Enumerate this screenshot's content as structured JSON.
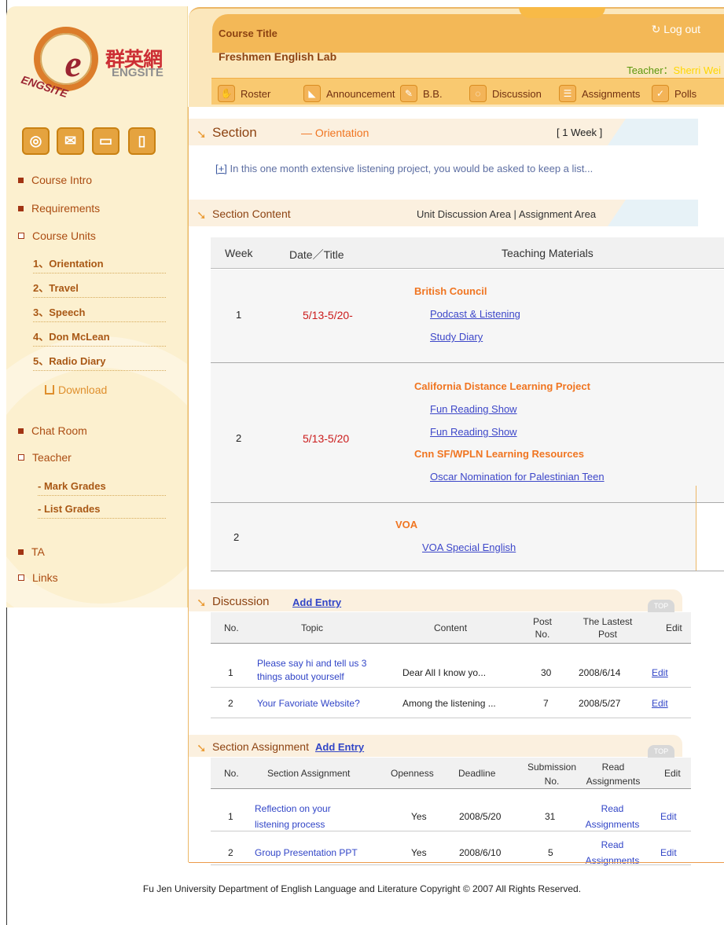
{
  "brand": {
    "cn": "群英網",
    "en": "ENGSITE",
    "circle": "ENGSITE"
  },
  "header": {
    "course_title": "Course Title",
    "course_name": "Freshmen English Lab",
    "logout": "Log out",
    "teacher_label": "Teacher：",
    "teacher_name": "Sherri Wei"
  },
  "nav": [
    {
      "label": "Roster",
      "icon": "hand-icon"
    },
    {
      "label": "Announcement",
      "icon": "megaphone-icon"
    },
    {
      "label": "B.B.",
      "icon": "pin-icon"
    },
    {
      "label": "Discussion",
      "icon": "chat-icon"
    },
    {
      "label": "Assignments",
      "icon": "doc-icon"
    },
    {
      "label": "Polls",
      "icon": "check-icon"
    }
  ],
  "sidebar": {
    "items": [
      "Course Intro",
      "Requirements",
      "Course Units",
      "Chat Room",
      "Teacher",
      "TA",
      "Links"
    ],
    "units": [
      "1、Orientation",
      "2、Travel",
      "3、Speech",
      "4、Don McLean",
      "5、Radio Diary"
    ],
    "download": "Download",
    "teacher_subs": [
      "- Mark Grades",
      "- List Grades"
    ]
  },
  "section": {
    "title": "Section",
    "desc": "— Orientation",
    "week": "[ 1 Week ]",
    "intro_prefix": "[+]",
    "intro": "In this one month extensive listening project, you would be asked to keep a list..."
  },
  "section_content": {
    "title": "Section Content",
    "links": "Unit Discussion Area | Assignment Area",
    "headers": [
      "Week",
      "Date／Title",
      "Teaching Materials"
    ],
    "rows": [
      {
        "week": "1",
        "date": "5/13-5/20-",
        "items": [
          {
            "type": "org",
            "text": "British Council"
          },
          {
            "type": "link",
            "text": "Podcast & Listening"
          },
          {
            "type": "link",
            "text": "Study Diary"
          }
        ]
      },
      {
        "week": "2",
        "date": "5/13-5/20",
        "items": [
          {
            "type": "org",
            "text": "California Distance Learning Project"
          },
          {
            "type": "link",
            "text": "Fun Reading Show"
          },
          {
            "type": "link",
            "text": "Fun Reading Show"
          },
          {
            "type": "org",
            "text": "Cnn SF/WPLN Learning Resources"
          },
          {
            "type": "link",
            "text": "Oscar Nomination for Palestinian Teen"
          }
        ]
      },
      {
        "week": "2",
        "date": "",
        "items": [
          {
            "type": "org",
            "text": "VOA"
          },
          {
            "type": "link",
            "text": "VOA Special English"
          }
        ]
      }
    ]
  },
  "discussion": {
    "title": "Discussion",
    "add": "Add Entry",
    "top": "TOP",
    "headers": [
      "No.",
      "Topic",
      "Content",
      "Post No.",
      "The Lastest Post",
      "Edit"
    ],
    "rows": [
      {
        "no": "1",
        "topic": "Please say hi and tell us 3 things about yourself",
        "content": "Dear All I know yo...",
        "posts": "30",
        "last": "2008/6/14",
        "edit": "Edit"
      },
      {
        "no": "2",
        "topic": "Your Favoriate Website?",
        "content": "Among the listening ...",
        "posts": "7",
        "last": "2008/5/27",
        "edit": "Edit"
      }
    ]
  },
  "assignment": {
    "title": "Section Assignment",
    "add": "Add Entry",
    "top": "TOP",
    "headers": [
      "No.",
      "Section Assignment",
      "Openness",
      "Deadline",
      "Submission No.",
      "Read Assignments",
      "Edit"
    ],
    "rows": [
      {
        "no": "1",
        "name": "Reflection on your listening process",
        "open": "Yes",
        "deadline": "2008/5/20",
        "sub": "31",
        "read": "Read Assignments",
        "edit": "Edit"
      },
      {
        "no": "2",
        "name": "Group Presentation PPT",
        "open": "Yes",
        "deadline": "2008/6/10",
        "sub": "5",
        "read": "Read Assignments",
        "edit": "Edit"
      }
    ]
  },
  "footer": "Fu Jen University Department of English Language and Literature Copyright © 2007 All Rights Reserved."
}
